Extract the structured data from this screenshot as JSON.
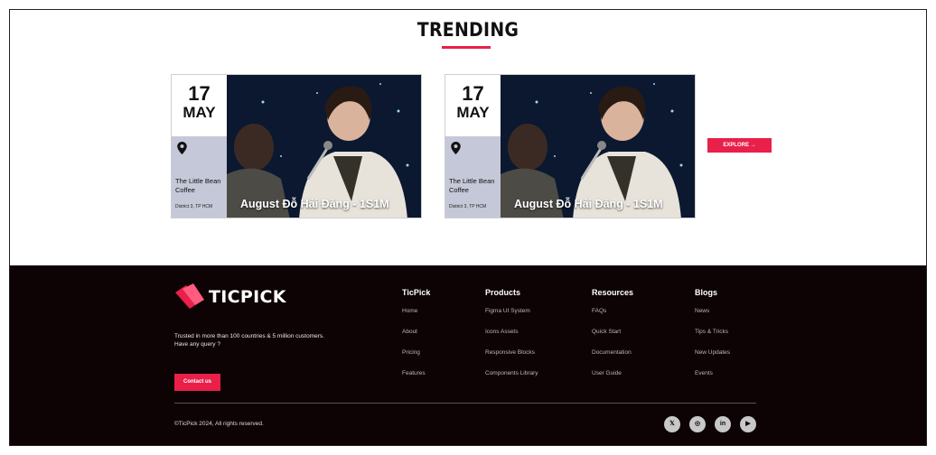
{
  "trending": {
    "title": "TRENDING",
    "cards": [
      {
        "day": "17",
        "month": "MAY",
        "venue": "The Little Bean Coffee",
        "district": "District 3, TP HCM",
        "event_title": "August Đỗ Hải Đăng - 1S1M",
        "pin_icon": "location-pin-icon"
      },
      {
        "day": "17",
        "month": "MAY",
        "venue": "The Little Bean Coffee",
        "district": "District 3, TP HCM",
        "event_title": "August Đỗ Hải Đăng - 1S1M",
        "pin_icon": "location-pin-icon"
      }
    ],
    "explore_label": "EXPLORE →"
  },
  "footer": {
    "logo_text": "TICPICK",
    "tagline": "Trusted in more than 100 countries & 5 million customers. Have any query ?",
    "contact_label": "Contact us",
    "columns": [
      {
        "title": "TicPick",
        "links": [
          "Home",
          "About",
          "Pricing",
          "Features"
        ]
      },
      {
        "title": "Products",
        "links": [
          "Figma UI System",
          "Icons Assets",
          "Responsive Blocks",
          "Components Library"
        ]
      },
      {
        "title": "Resources",
        "links": [
          "FAQs",
          "Quick Start",
          "Documentation",
          "User Guide"
        ]
      },
      {
        "title": "Blogs",
        "links": [
          "News",
          "Tips & Tricks",
          "New Updates",
          "Events"
        ]
      }
    ],
    "copyright": "©TicPick 2024, All rights reserved.",
    "social": [
      {
        "name": "x-icon",
        "glyph": "𝕏"
      },
      {
        "name": "instagram-icon",
        "glyph": "◎"
      },
      {
        "name": "linkedin-icon",
        "glyph": "in"
      },
      {
        "name": "youtube-icon",
        "glyph": "▶"
      }
    ]
  },
  "colors": {
    "accent": "#e8204a",
    "footer_bg": "#0d0204",
    "info_bg": "#c5c8d8"
  }
}
